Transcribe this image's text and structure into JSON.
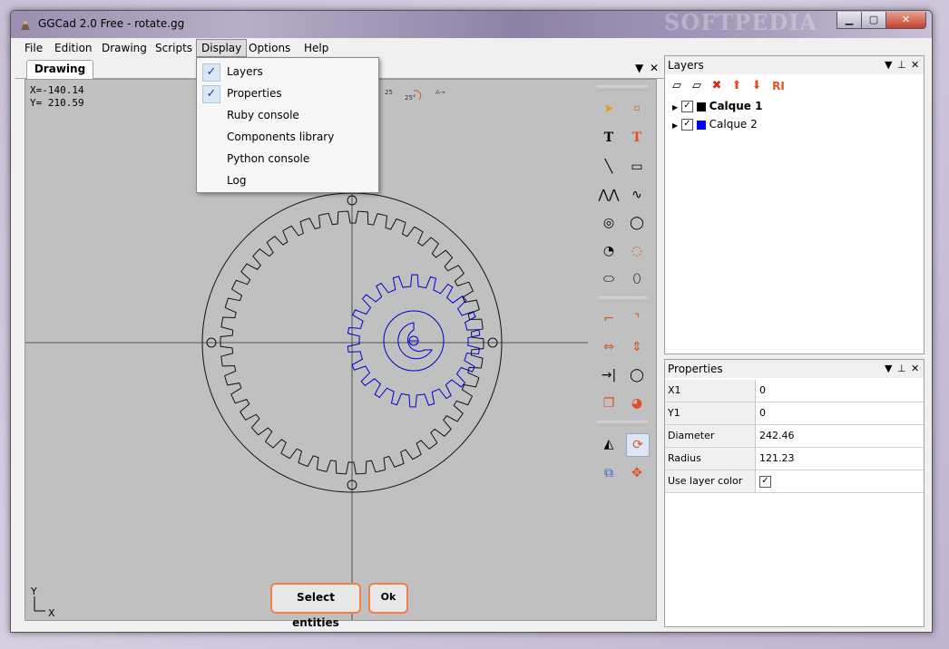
{
  "window": {
    "title": "GGCad 2.0 Free - rotate.gg",
    "watermark": "SOFTPEDIA"
  },
  "menu": [
    "File",
    "Edition",
    "Drawing",
    "Scripts",
    "Display",
    "Options",
    "Help"
  ],
  "display_menu": {
    "items": [
      {
        "label": "Layers",
        "checked": true
      },
      {
        "label": "Properties",
        "checked": true
      },
      {
        "label": "Ruby console",
        "checked": false
      },
      {
        "label": "Components library",
        "checked": false
      },
      {
        "label": "Python console",
        "checked": false
      },
      {
        "label": "Log",
        "checked": false
      }
    ]
  },
  "drawing": {
    "tab_label": "Drawing",
    "coord_x": "X=-140.14",
    "coord_y": "Y= 210.59",
    "axis_y": "Y",
    "axis_x": "X",
    "top_tools": [
      "25",
      "25°"
    ],
    "select_button": "Select entities",
    "ok_button": "Ok",
    "text_tool": "T"
  },
  "layers": {
    "title": "Layers",
    "tool_label": "RI",
    "items": [
      {
        "name": "Calque 1",
        "color": "#000000",
        "bold": true,
        "checked": true
      },
      {
        "name": "Calque 2",
        "color": "#0000ff",
        "bold": false,
        "checked": true
      }
    ]
  },
  "properties": {
    "title": "Properties",
    "rows": [
      {
        "key": "X1",
        "value": "0"
      },
      {
        "key": "Y1",
        "value": "0"
      },
      {
        "key": "Diameter",
        "value": "242.46"
      },
      {
        "key": "Radius",
        "value": "121.23"
      },
      {
        "key": "Use layer color",
        "value": ""
      }
    ]
  },
  "colors": {
    "accent": "#f07f4a",
    "gear_blue": "#0000cc",
    "canvas": "#c0c0c0"
  }
}
